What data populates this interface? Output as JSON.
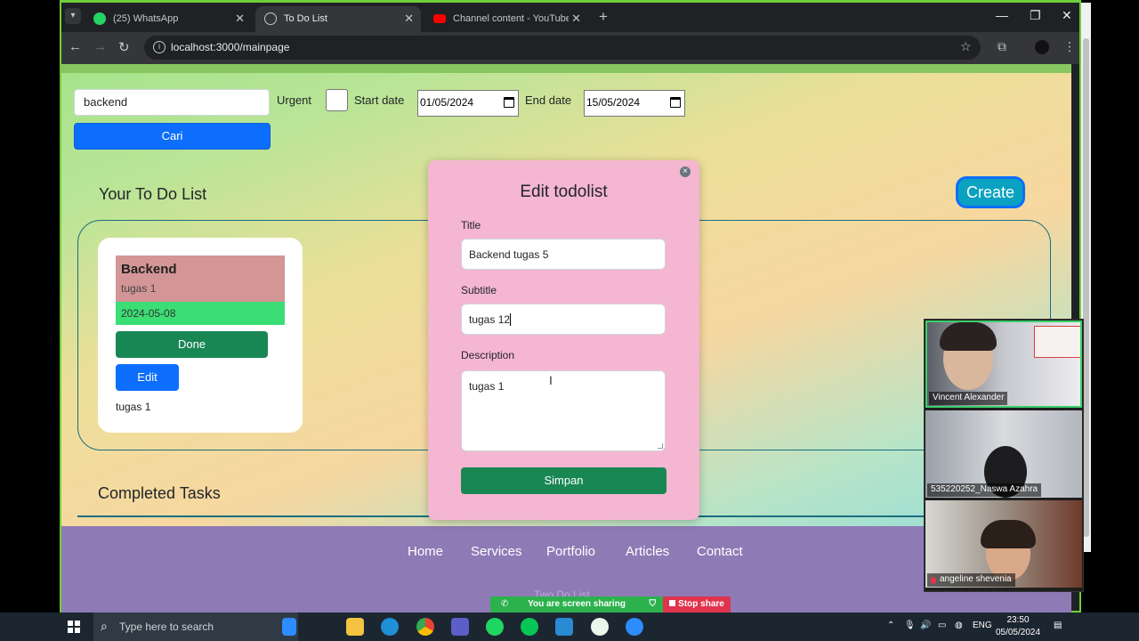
{
  "browser": {
    "tabs": [
      {
        "label": "(25) WhatsApp",
        "icon": "whatsapp-icon"
      },
      {
        "label": "To Do List",
        "icon": "globe-icon"
      },
      {
        "label": "Channel content - YouTube Stu",
        "icon": "youtube-icon"
      }
    ],
    "url": "localhost:3000/mainpage"
  },
  "filters": {
    "search_value": "backend",
    "search_button": "Cari",
    "urgent_label": "Urgent",
    "start_label": "Start date",
    "start_value": "01/05/2024",
    "end_label": "End date",
    "end_value": "15/05/2024"
  },
  "list": {
    "title": "Your To Do List",
    "create_label": "Create"
  },
  "card": {
    "title": "Backend",
    "subtitle": "tugas 1",
    "date": "2024-05-08",
    "done_label": "Done",
    "edit_label": "Edit",
    "description": "tugas 1"
  },
  "completed": {
    "title": "Completed Tasks"
  },
  "footer": {
    "links": [
      "Home",
      "Services",
      "Portfolio",
      "Articles",
      "Contact"
    ],
    "brand": "Two Do List"
  },
  "modal": {
    "title": "Edit todolist",
    "title_label": "Title",
    "title_value": "Backend tugas 5",
    "subtitle_label": "Subtitle",
    "subtitle_value": "tugas 12",
    "description_label": "Description",
    "description_value": "tugas 1",
    "save_label": "Simpan"
  },
  "call": {
    "participants": [
      "Vincent Alexander",
      "535220252_Naswa Azahra",
      "angeline shevenia"
    ],
    "sharing_text": "You are screen sharing",
    "stop_share_label": "Stop share"
  },
  "taskbar": {
    "search_placeholder": "Type here to search",
    "language": "ENG",
    "time": "23:50",
    "date": "05/05/2024"
  },
  "colors": {
    "primary": "#0d6efd",
    "success": "#198754",
    "modal_bg": "#f5b6d1",
    "footer_bg": "#8e7ab5",
    "card_head": "#d39595",
    "card_date": "#3bde74"
  }
}
